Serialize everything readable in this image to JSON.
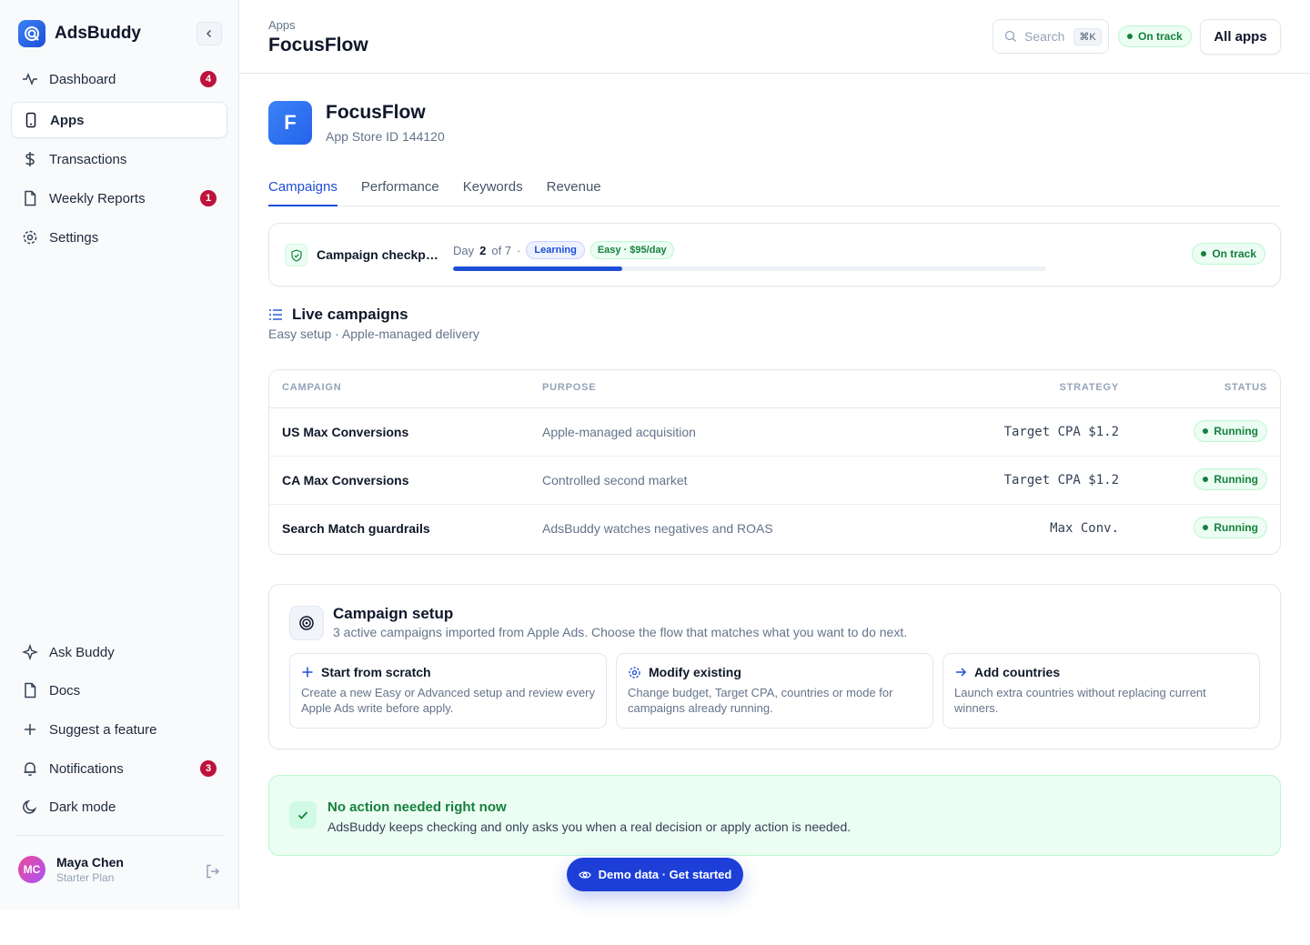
{
  "brand": {
    "name": "AdsBuddy"
  },
  "sidebar": {
    "items": [
      {
        "label": "Dashboard",
        "icon": "activity-icon",
        "badge": "4"
      },
      {
        "label": "Apps",
        "icon": "smartphone-icon",
        "badge": ""
      },
      {
        "label": "Transactions",
        "icon": "dollar-icon",
        "badge": ""
      },
      {
        "label": "Weekly Reports",
        "icon": "file-icon",
        "badge": "1"
      },
      {
        "label": "Settings",
        "icon": "gear-icon",
        "badge": ""
      }
    ],
    "bottom_items": [
      {
        "label": "Ask Buddy",
        "icon": "sparkle-icon",
        "badge": ""
      },
      {
        "label": "Docs",
        "icon": "file-icon",
        "badge": ""
      },
      {
        "label": "Suggest a feature",
        "icon": "plus-icon",
        "badge": ""
      },
      {
        "label": "Notifications",
        "icon": "bell-icon",
        "badge": "3"
      },
      {
        "label": "Dark mode",
        "icon": "moon-icon",
        "badge": ""
      }
    ],
    "user": {
      "initials": "MC",
      "name": "Maya Chen",
      "plan": "Starter Plan"
    }
  },
  "header": {
    "breadcrumb": "Apps",
    "title": "FocusFlow",
    "search_placeholder": "Search",
    "search_shortcut": "⌘K",
    "status": "On track",
    "all_apps_label": "All apps"
  },
  "app": {
    "initial": "F",
    "name": "FocusFlow",
    "store_id": "App Store ID 144120"
  },
  "tabs": [
    "Campaigns",
    "Performance",
    "Keywords",
    "Revenue"
  ],
  "checkpoint": {
    "title": "Campaign checkpoint",
    "day_prefix": "Day",
    "day_current": "2",
    "day_suffix": "of 7",
    "learning_label": "Learning",
    "mode_label": "Easy · $95/day",
    "progress_fraction": 0.2857,
    "status": "On track"
  },
  "live": {
    "title": "Live campaigns",
    "subtitle": "Easy setup · Apple-managed delivery"
  },
  "table": {
    "headers": [
      "CAMPAIGN",
      "PURPOSE",
      "STRATEGY",
      "STATUS"
    ],
    "rows": [
      {
        "campaign": "US Max Conversions",
        "purpose": "Apple-managed acquisition",
        "strategy": "Target CPA $1.2",
        "status": "Running"
      },
      {
        "campaign": "CA Max Conversions",
        "purpose": "Controlled second market",
        "strategy": "Target CPA $1.2",
        "status": "Running"
      },
      {
        "campaign": "Search Match guardrails",
        "purpose": "AdsBuddy watches negatives and ROAS",
        "strategy": "Max Conv.",
        "status": "Running"
      }
    ]
  },
  "setup": {
    "title": "Campaign setup",
    "subtitle": "3 active campaigns imported from Apple Ads. Choose the flow that matches what you want to do next.",
    "options": [
      {
        "title": "Start from scratch",
        "icon": "plus-icon",
        "body": "Create a new Easy or Advanced setup and review every Apple Ads write before apply."
      },
      {
        "title": "Modify existing",
        "icon": "gear-icon",
        "body": "Change budget, Target CPA, countries or mode for campaigns already running."
      },
      {
        "title": "Add countries",
        "icon": "arrow-right-icon",
        "body": "Launch extra countries without replacing current winners."
      }
    ]
  },
  "no_action": {
    "title": "No action needed right now",
    "body": "AdsBuddy keeps checking and only asks you when a real decision or apply action is needed."
  },
  "demo": {
    "label": "Demo data · Get started"
  },
  "colors": {
    "accent": "#1d4ed8",
    "success": "#15803d",
    "danger": "#be123c"
  }
}
